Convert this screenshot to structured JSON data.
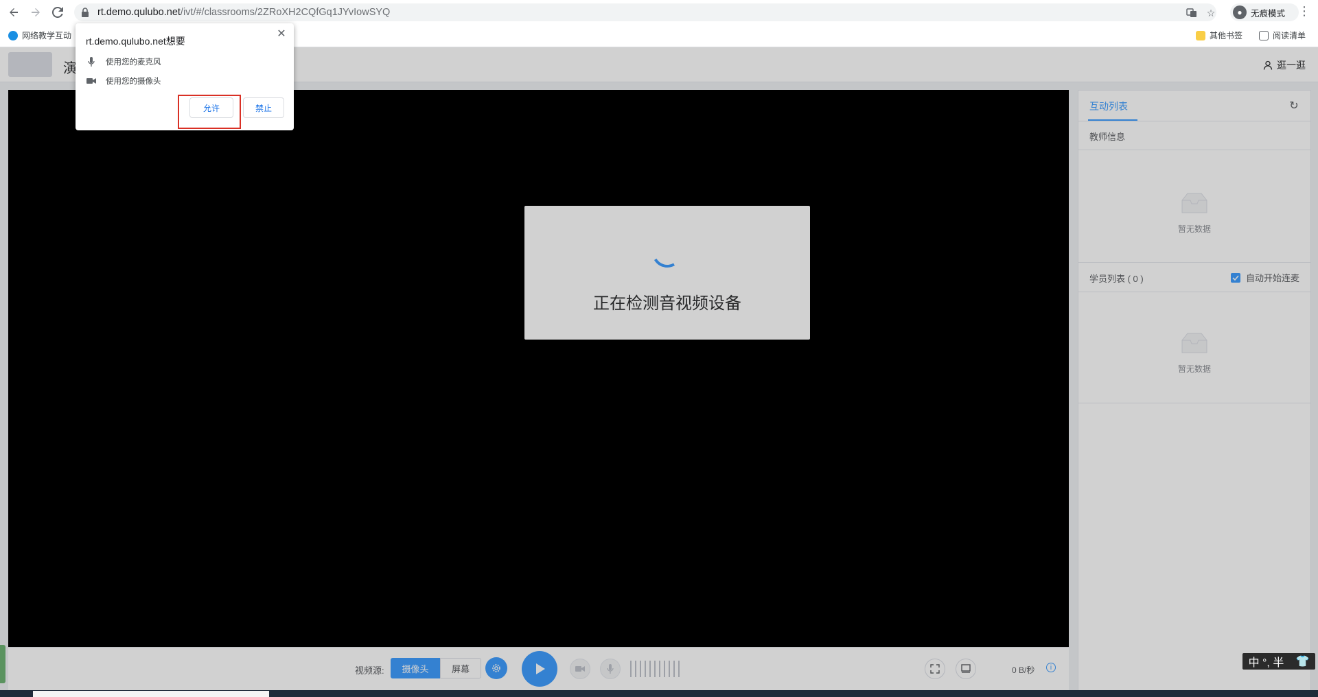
{
  "browser": {
    "url_host": "rt.demo.qulubo.net",
    "url_path": "/ivt/#/classrooms/2ZRoXH2CQfGq1JYvIowSYQ",
    "incognito_label": "无痕模式",
    "bookmarks": {
      "left_item": "网络教学互动",
      "other_bookmarks": "其他书签",
      "reading_list": "阅读清单"
    }
  },
  "permission_prompt": {
    "title": "rt.demo.qulubo.net想要",
    "mic_label": "使用您的麦克风",
    "camera_label": "使用您的摄像头",
    "allow_label": "允许",
    "block_label": "禁止"
  },
  "app": {
    "title_partial": "演",
    "user_link": "逛一逛",
    "detect_text": "正在检测音视频设备",
    "controls": {
      "source_label": "视频源:",
      "camera_btn": "摄像头",
      "screen_btn": "屏幕",
      "rate": "0 B/秒"
    },
    "panel": {
      "tab_label": "互动列表",
      "teacher_section": "教师信息",
      "empty_text_1": "暂无数据",
      "student_section": "学员列表 ( 0 )",
      "auto_mic_label": "自动开始连麦",
      "empty_text_2": "暂无数据"
    }
  },
  "ime": {
    "label": "中 °, 半"
  },
  "colors": {
    "accent": "#409eff",
    "highlight_border": "#d93025"
  }
}
